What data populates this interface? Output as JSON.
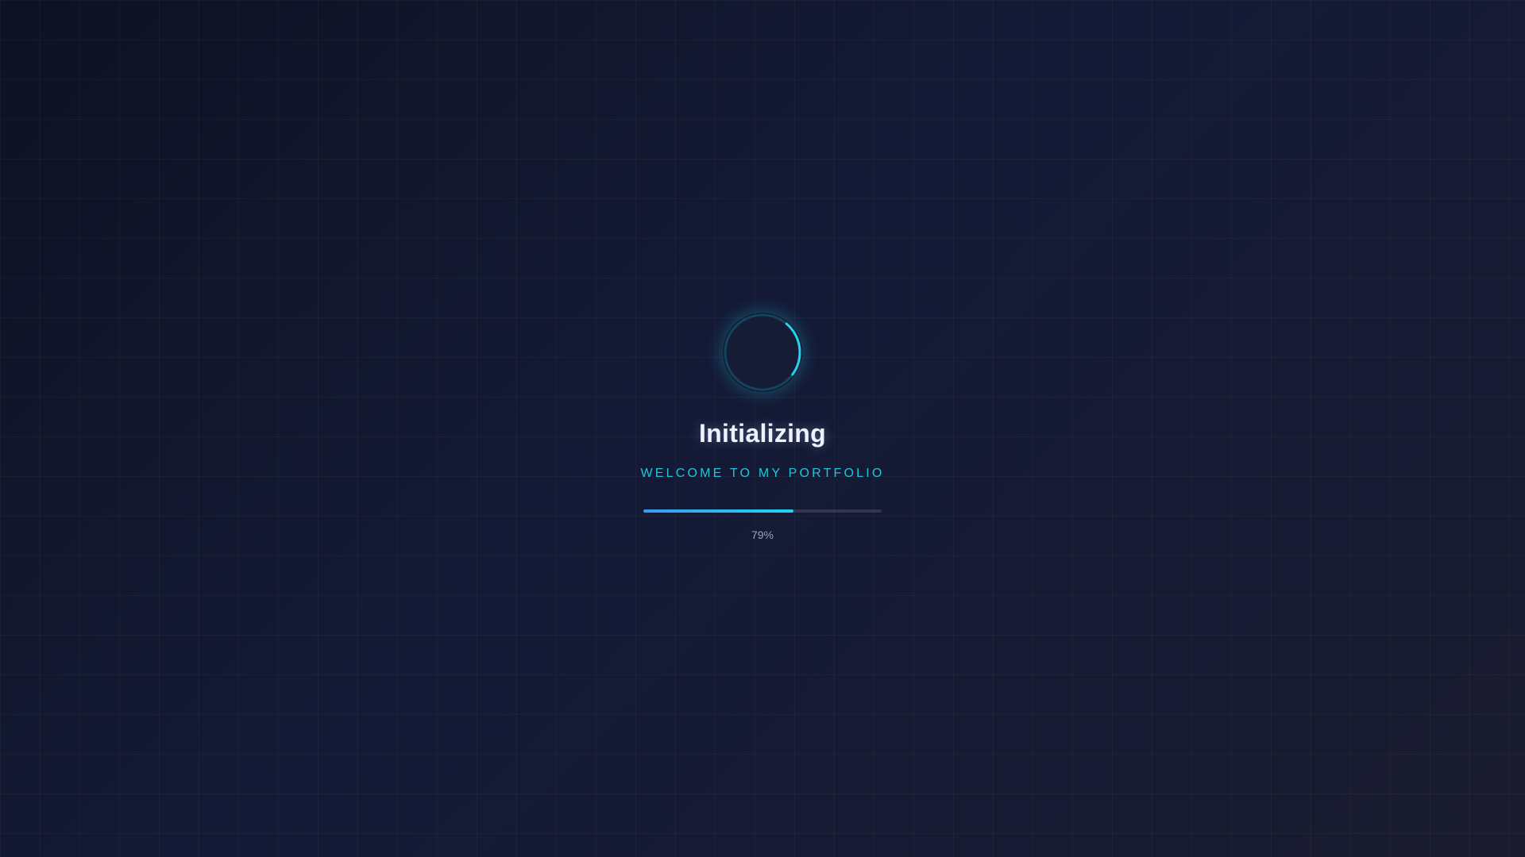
{
  "loader": {
    "title": "Initializing",
    "subtitle": "WELCOME TO MY PORTFOLIO",
    "progress_percent": 63,
    "percent_label": "79%",
    "spinner_icon": "loading-spinner-icon"
  },
  "colors": {
    "accent": "#22d3ee",
    "accent_blue": "#3b9cf0",
    "title": "#eef2ff",
    "subtitle": "#22c5d8",
    "background": "#141a36"
  }
}
